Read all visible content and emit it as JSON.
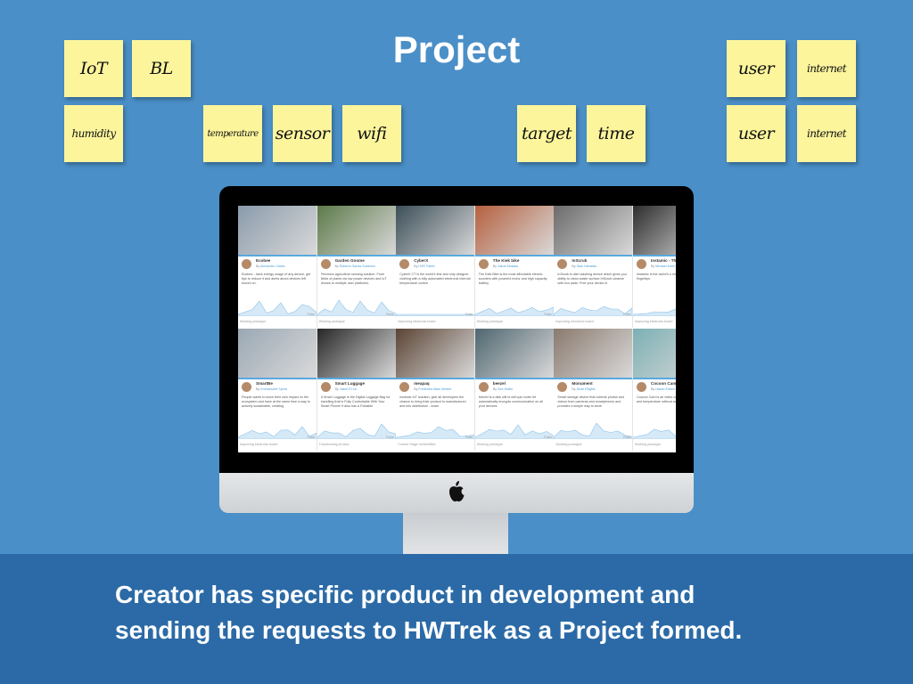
{
  "title": "Project",
  "notes": {
    "iot": "IoT",
    "bl": "BL",
    "humidity": "humidity",
    "temperature": "temperature",
    "sensor": "sensor",
    "wifi": "wifi",
    "target": "target",
    "time": "time",
    "user_1": "user",
    "internet_1": "internet",
    "user_2": "user",
    "internet_2": "internet"
  },
  "cards": [
    {
      "title": "Ecobee",
      "by": "Alexander Clarke",
      "desc": "Ecobee - track energy usage of any device, get tips to reduce it and alerts about devices left turned on.",
      "stage": "Working prototype",
      "color": "#8a9bab"
    },
    {
      "title": "Garden Gnome",
      "by": "Roberto Garcia Gutierrez",
      "desc": "Precision agriculture sensing solution. From fields of plants via low power devices and IoT drones to multiple user platforms.",
      "stage": "Working prototype",
      "color": "#5d7a4a"
    },
    {
      "title": "CyberX",
      "by": "HXR Fabric",
      "desc": "CyberX CT is the world's first and only designer clothing with a fully automated electronic internal temperature control",
      "stage": "Improving electronic board",
      "color": "#3b4e58"
    },
    {
      "title": "The Kiek bike",
      "by": "Jakub Musiała",
      "desc": "The Kiek Bike is the most affordable electric scooters with powerful motor and high capacity battery",
      "stage": "Working prototype",
      "color": "#b5603f"
    },
    {
      "title": "InScrub",
      "by": "Stan Hamidan",
      "desc": "InScrub is dish washing device which gives you ability to clean waste surface InScrub cleanse with eco pads. Free your device in",
      "stage": "Improving electronic board",
      "color": "#6b6b6b"
    },
    {
      "title": "Instamic - The",
      "by": "Michael Kuhn",
      "desc": "Instamic is the world's s microphone ready to re fingertips",
      "stage": "Improving electronic board",
      "color": "#2d2d2d"
    },
    {
      "title": "SmartBe",
      "by": "Emmanuele Spera",
      "desc": "People wants to know their own impact on the ecosystem and have at the same time a way to actively sustainable, creating",
      "stage": "Improving electronic board",
      "color": "#9aa8b4"
    },
    {
      "title": "Smart Luggage",
      "by": "Jason El Lin",
      "desc": "A Smart Luggage is the Digital Luggage Bag for travelling that is Fully Controllable With Your Smart Phone! It also has a Foldable",
      "stage": "Transforming an idea",
      "color": "#272727"
    },
    {
      "title": "meapaq",
      "by": "Frederika Mass Wester",
      "desc": "modular IoT solution, give all developers the chance to bring their product to manufactured and into distribution - lower",
      "stage": "Current Stage Unidentified",
      "color": "#5a4434"
    },
    {
      "title": "beezel",
      "by": "Dee Moller",
      "desc": "beezel is a disk will to will ops router let automatically encrypts communication on all your devices",
      "stage": "Working prototype",
      "color": "#4f6670"
    },
    {
      "title": "Monument",
      "by": "Dean Ellighis",
      "desc": "Smart storage device that collects photos and videos from cameras and smartphones and provides a simple way to store",
      "stage": "Working prototype",
      "color": "#8a7a6e"
    },
    {
      "title": "Cocoon Cam",
      "by": "Hasan Erdem",
      "desc": "Cocoon Cam is an video can detect the heart and temperature without and",
      "stage": "Working prototype",
      "color": "#7cb0b4"
    }
  ],
  "pulse_label": "Pulse",
  "by_prefix": "By",
  "footer": {
    "line1": "Creator has specific product in development and",
    "line2": "sending the requests to HWTrek as a Project formed."
  }
}
